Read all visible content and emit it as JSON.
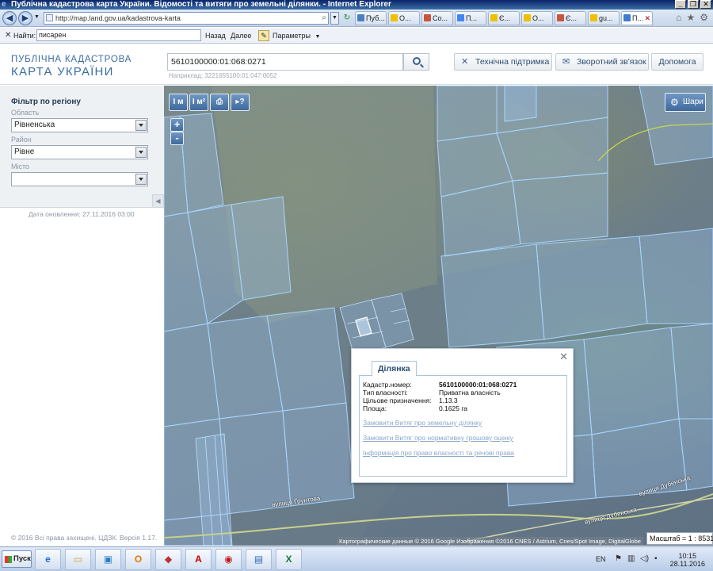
{
  "window": {
    "title": "Публічна кадастрова карта України. Відомості та витяги про земельні ділянки. - Internet Explorer"
  },
  "browser": {
    "url": "http://map.land.gov.ua/kadastrova-karta",
    "tabs": [
      {
        "label": "Пуб...",
        "color": "#4a7fc1"
      },
      {
        "label": "О...",
        "color": "#f0c000"
      },
      {
        "label": "Со...",
        "color": "#c8553d"
      },
      {
        "label": "П...",
        "color": "#4285f4"
      },
      {
        "label": "Є...",
        "color": "#f0c000"
      },
      {
        "label": "О...",
        "color": "#f0c000"
      },
      {
        "label": "Є...",
        "color": "#c8553d"
      },
      {
        "label": "gu...",
        "color": "#f0c000"
      },
      {
        "label": "П...",
        "color": "#3f7bd0"
      }
    ]
  },
  "findbar": {
    "label": "Найти:",
    "value": "писарен",
    "prev_label": "Назад",
    "next_label": "Далее",
    "params_label": "Параметры"
  },
  "header": {
    "logo_line1": "ПУБЛІЧНА КАДАСТРОВА",
    "logo_line2": "КАРТА УКРАЇНИ",
    "search_value": "5610100000:01:068:0271",
    "search_hint": "Наприклад: 3221655100:01:047:0052",
    "support_label": "Технічна підтримка",
    "feedback_label": "Зворотний зв'язок",
    "help_label": "Допомога"
  },
  "filter": {
    "title": "Фільтр по регіону",
    "region_label": "Область",
    "region_value": "Рівненська",
    "district_label": "Район",
    "district_value": "Рівне",
    "city_label": "Місто",
    "city_value": "",
    "updated": "Дата оновлення: 27.11.2016 03:00",
    "footer": "© 2016 Всі права захищені. ЦДЗК. Версія 1.17."
  },
  "map": {
    "layers_label": "Шари",
    "zoom_in": "+",
    "zoom_out": "-",
    "tool_labels": [
      "I м",
      "I м²",
      "⎙",
      "▸?"
    ],
    "streets": [
      "вулиця Дубенська",
      "вулиця Ґрунтова",
      "вулиця Дубенська"
    ],
    "attribution": "Картографические данные © 2016 Google Изображения ©2016 CNES / Astrium, Cnes/Spot Image, DigitalGlobe",
    "scale": "Масштаб = 1 : 8531"
  },
  "popup": {
    "tab_label": "Ділянка",
    "rows": [
      {
        "key": "Кадастр.номер:",
        "value": "5610100000:01:068:0271"
      },
      {
        "key": "Тип власності:",
        "value": "Приватна власність"
      },
      {
        "key": "Цільове призначення:",
        "value": "1.13.3"
      },
      {
        "key": "Площа:",
        "value": "0.1625 га"
      }
    ],
    "links": [
      "Замовити Витяг про земельну ділянку",
      "Замовити Витяг про нормативну грошову оцінку",
      "Інформація про право власності та речові права"
    ]
  },
  "taskbar": {
    "start_label": "Пуск",
    "apps": [
      {
        "glyph": "e",
        "color": "#1e6fd1"
      },
      {
        "glyph": "▭",
        "color": "#c9a227"
      },
      {
        "glyph": "▣",
        "color": "#2a7fc5"
      },
      {
        "glyph": "O",
        "color": "#e07b00"
      },
      {
        "glyph": "◆",
        "color": "#b33"
      },
      {
        "glyph": "A",
        "color": "#c00"
      },
      {
        "glyph": "◉",
        "color": "#c01c1c"
      },
      {
        "glyph": "▤",
        "color": "#2f6db5"
      },
      {
        "glyph": "X",
        "color": "#1d7a36"
      }
    ],
    "lang": "EN",
    "time": "10:15",
    "date": "28.11.2016"
  }
}
